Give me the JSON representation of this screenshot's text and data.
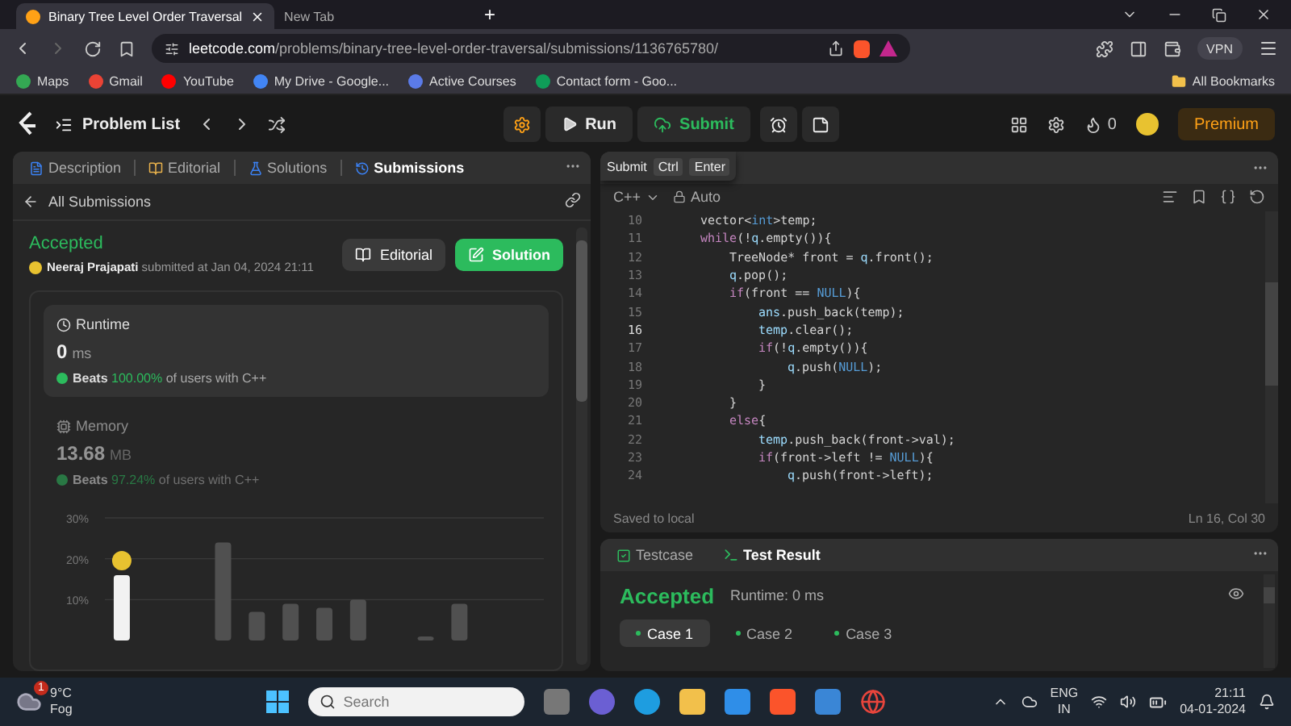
{
  "browser": {
    "tabs": [
      {
        "title": "Binary Tree Level Order Traversal",
        "selected": true
      },
      {
        "title": "New Tab",
        "selected": false
      }
    ],
    "new_tab": "+",
    "url_host": "leetcode.com",
    "url_path": "/problems/binary-tree-level-order-traversal/submissions/1136765780/",
    "vpn": "VPN",
    "bookmarks": [
      {
        "label": "Maps",
        "color": "#34a853"
      },
      {
        "label": "Gmail",
        "color": "#ea4335"
      },
      {
        "label": "YouTube",
        "color": "#ff0000"
      },
      {
        "label": "My Drive - Google...",
        "color": "#4285f4"
      },
      {
        "label": "Active Courses",
        "color": "#5b7be8"
      },
      {
        "label": "Contact form - Goo...",
        "color": "#0f9d58"
      }
    ],
    "all_bookmarks": "All Bookmarks"
  },
  "topbar": {
    "problem_list": "Problem List",
    "run": "Run",
    "submit": "Submit",
    "streak": "0",
    "premium": "Premium"
  },
  "tooltip": {
    "label": "Submit",
    "keys": [
      "Ctrl",
      "Enter"
    ]
  },
  "left_panel": {
    "tabs": [
      {
        "label": "Description",
        "selected": false
      },
      {
        "label": "Editorial",
        "selected": false
      },
      {
        "label": "Solutions",
        "selected": false
      },
      {
        "label": "Submissions",
        "selected": true
      }
    ],
    "back": "All Submissions",
    "status": "Accepted",
    "author": "Neeraj Prajapati",
    "submitted": "submitted at Jan 04, 2024 21:11",
    "editorial_button": "Editorial",
    "solution_button": "Solution",
    "stats": [
      {
        "kind": "runtime",
        "title": "Runtime",
        "value": "0",
        "unit": "ms",
        "beats_label": "Beats",
        "beats_value": "100.00%",
        "beats_suffix": "of users with C++",
        "selected": true
      },
      {
        "kind": "memory",
        "title": "Memory",
        "value": "13.68",
        "unit": "MB",
        "beats_label": "Beats",
        "beats_value": "97.24%",
        "beats_suffix": "of users with C++",
        "selected": false
      }
    ],
    "chart_data": {
      "type": "bar",
      "ylim": [
        0,
        30
      ],
      "yticks": [
        {
          "value": 10,
          "label": "10%"
        },
        {
          "value": 20,
          "label": "20%"
        },
        {
          "value": 30,
          "label": "30%"
        }
      ],
      "series": [
        {
          "color": "#f2f2f2",
          "values": [
            16,
            null,
            null,
            null,
            null,
            null,
            null,
            null,
            null,
            null,
            null,
            null,
            null
          ]
        },
        {
          "color": "#505050",
          "values": [
            null,
            null,
            null,
            24,
            7,
            9,
            8,
            10,
            null,
            1,
            9,
            null,
            null
          ]
        }
      ]
    }
  },
  "editor": {
    "language": "C++",
    "mode": "Auto",
    "saved": "Saved to local",
    "position": "Ln 16, Col 30",
    "lines": [
      {
        "number": "10",
        "current": false,
        "tokens": [
          {
            "text": "vector<",
            "kind": "plain"
          },
          {
            "text": "int",
            "kind": "type"
          },
          {
            "text": ">temp;",
            "kind": "plain"
          }
        ]
      },
      {
        "number": "11",
        "current": false,
        "tokens": [
          {
            "text": "while",
            "kind": "keyword"
          },
          {
            "text": "(!",
            "kind": "plain"
          },
          {
            "text": "q",
            "kind": "ident"
          },
          {
            "text": ".empty()){",
            "kind": "plain"
          }
        ],
        "children": [
          {
            "number": "12",
            "current": false,
            "tokens": [
              {
                "text": "TreeNode* front = ",
                "kind": "plain"
              },
              {
                "text": "q",
                "kind": "ident"
              },
              {
                "text": ".front();",
                "kind": "plain"
              }
            ]
          },
          {
            "number": "13",
            "current": false,
            "tokens": [
              {
                "text": "q",
                "kind": "ident"
              },
              {
                "text": ".pop();",
                "kind": "plain"
              }
            ]
          },
          {
            "number": "14",
            "current": false,
            "tokens": [
              {
                "text": "if",
                "kind": "keyword"
              },
              {
                "text": "(front == ",
                "kind": "plain"
              },
              {
                "text": "NULL",
                "kind": "type"
              },
              {
                "text": "){",
                "kind": "plain"
              }
            ],
            "children": [
              {
                "number": "15",
                "current": false,
                "tokens": [
                  {
                    "text": "ans",
                    "kind": "ident"
                  },
                  {
                    "text": ".push_back(temp);",
                    "kind": "plain"
                  }
                ]
              },
              {
                "number": "16",
                "current": true,
                "tokens": [
                  {
                    "text": "temp",
                    "kind": "ident"
                  },
                  {
                    "text": ".clear();",
                    "kind": "plain"
                  }
                ]
              },
              {
                "number": "17",
                "current": false,
                "tokens": [
                  {
                    "text": "if",
                    "kind": "keyword"
                  },
                  {
                    "text": "(!",
                    "kind": "plain"
                  },
                  {
                    "text": "q",
                    "kind": "ident"
                  },
                  {
                    "text": ".empty()){",
                    "kind": "plain"
                  }
                ],
                "children": [
                  {
                    "number": "18",
                    "current": false,
                    "tokens": [
                      {
                        "text": "q",
                        "kind": "ident"
                      },
                      {
                        "text": ".push(",
                        "kind": "plain"
                      },
                      {
                        "text": "NULL",
                        "kind": "type"
                      },
                      {
                        "text": ");",
                        "kind": "plain"
                      }
                    ]
                  }
                ]
              },
              {
                "number": "19",
                "current": false,
                "tokens": [
                  {
                    "text": "}",
                    "kind": "plain"
                  }
                ]
              }
            ]
          },
          {
            "number": "20",
            "current": false,
            "tokens": [
              {
                "text": "}",
                "kind": "plain"
              }
            ]
          },
          {
            "number": "21",
            "current": false,
            "tokens": [
              {
                "text": "else",
                "kind": "keyword"
              },
              {
                "text": "{",
                "kind": "plain"
              }
            ],
            "children": [
              {
                "number": "22",
                "current": false,
                "tokens": [
                  {
                    "text": "temp",
                    "kind": "ident"
                  },
                  {
                    "text": ".push_back(front->val);",
                    "kind": "plain"
                  }
                ]
              },
              {
                "number": "23",
                "current": false,
                "tokens": [
                  {
                    "text": "if",
                    "kind": "keyword"
                  },
                  {
                    "text": "(front->left != ",
                    "kind": "plain"
                  },
                  {
                    "text": "NULL",
                    "kind": "type"
                  },
                  {
                    "text": "){",
                    "kind": "plain"
                  }
                ],
                "children": [
                  {
                    "number": "24",
                    "current": false,
                    "tokens": [
                      {
                        "text": "q",
                        "kind": "ident"
                      },
                      {
                        "text": ".push(front->left);",
                        "kind": "plain"
                      }
                    ]
                  }
                ]
              }
            ]
          }
        ]
      }
    ]
  },
  "console": {
    "tabs": [
      {
        "label": "Testcase",
        "selected": false
      },
      {
        "label": "Test Result",
        "selected": true
      }
    ],
    "status": "Accepted",
    "runtime": "Runtime: 0 ms",
    "cases": [
      {
        "label": "Case 1",
        "selected": true
      },
      {
        "label": "Case 2",
        "selected": false
      },
      {
        "label": "Case 3",
        "selected": false
      }
    ]
  },
  "taskbar": {
    "weather_badge": "1",
    "temperature": "9°C",
    "condition": "Fog",
    "search": {
      "placeholder": "Search"
    },
    "language": "ENG",
    "region": "IN",
    "time": "21:11",
    "date": "04-01-2024"
  }
}
